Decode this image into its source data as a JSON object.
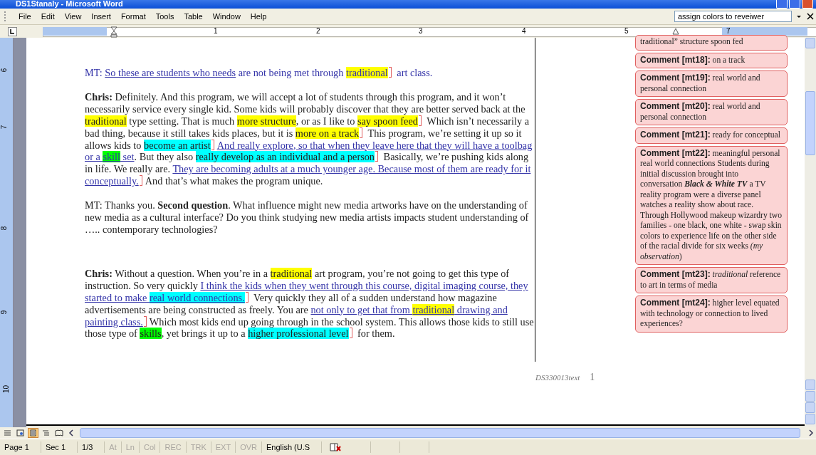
{
  "window": {
    "title": "DS1Stanaly - Microsoft Word"
  },
  "menu": [
    "File",
    "Edit",
    "View",
    "Insert",
    "Format",
    "Tools",
    "Table",
    "Window",
    "Help"
  ],
  "question_box": {
    "value": "assign colors to reveiwer"
  },
  "ruler": {
    "numbers": [
      "1",
      "2",
      "3",
      "4",
      "5",
      "7"
    ]
  },
  "vertical_ruler": {
    "numbers": [
      "6",
      "7",
      "8",
      "9",
      "10"
    ]
  },
  "paragraphs": [
    {
      "tracked": true,
      "runs": [
        {
          "text": "MT: "
        },
        {
          "text": "So these are students who needs",
          "inserted": true
        },
        {
          "text": " are not being met through "
        },
        {
          "text": "traditional",
          "color": "#ffff00",
          "comment": true
        },
        {
          "text": " art class."
        }
      ]
    },
    {
      "runs": [
        {
          "text": "Chris:",
          "bold": true
        },
        {
          "text": " Definitely.  And this program, we will accept a lot of students through this program, and it won’t necessarily service every single kid.  Some kids will probably discover that they are better served back at the "
        },
        {
          "text": "traditional",
          "color": "#ffff00"
        },
        {
          "text": " type setting.  That is much "
        },
        {
          "text": "more structure",
          "color": "#ffff00"
        },
        {
          "text": ", or as I like to "
        },
        {
          "text": "say spoon feed",
          "color": "#ffff00",
          "comment": true
        },
        {
          "text": "  Which isn’t necessarily a bad thing, because it still takes kids places, but it is "
        },
        {
          "text": "more on a track",
          "color": "#ffff00",
          "comment": true
        },
        {
          "text": "  This program, we’re setting it up so it allows kids to "
        },
        {
          "text": "become an artist",
          "color": "#00ffff",
          "comment": true
        },
        {
          "text": "And really explore, so that when they leave here that they will have a toolbag or a ",
          "inserted": true
        },
        {
          "text": "skill",
          "color": "#00ff00",
          "inserted": true
        },
        {
          "text": " set",
          "inserted": true
        },
        {
          "text": ".  But they also "
        },
        {
          "text": "really develop as an individual and a person",
          "color": "#00ffff",
          "comment": true
        },
        {
          "text": "  Basically, we’re pushing kids along in life.  We really are.  "
        },
        {
          "text": "They are becoming adults at a much younger age. Because most of them are ready for it conceptually.",
          "inserted": true,
          "comment": true
        },
        {
          "text": "And that’s what makes the program unique."
        }
      ]
    },
    {
      "runs": [
        {
          "text": "MT: Thanks you. "
        },
        {
          "text": "Second question",
          "bold": true
        },
        {
          "text": ". What influence might new media artworks have on the understanding of new media as a cultural interface? Do you think studying new media artists impacts student understanding of ….. contemporary technologies?"
        }
      ]
    },
    {
      "runs": [
        {
          "text": "Chris:",
          "bold": true
        },
        {
          "text": " Without a question.  When you’re in a "
        },
        {
          "text": "traditional",
          "color": "#ffff00"
        },
        {
          "text": " art program, you’re not going to get this type of instruction.  So very quickly "
        },
        {
          "text": "I think the kids when they went through this course, digital imaging course, they started to make ",
          "inserted": true
        },
        {
          "text": "real world connections.",
          "color": "#00ffff",
          "inserted": true,
          "comment": true
        },
        {
          "text": " Very quickly they all of a sudden understand how magazine advertisements are being constructed as freely.  You are "
        },
        {
          "text": "not only to get that from ",
          "inserted": true
        },
        {
          "text": "traditional",
          "color": "#ffff00",
          "inserted": true
        },
        {
          "text": " drawing and painting class.",
          "inserted": true,
          "comment": true
        },
        {
          "text": "Which most kids end up going through in the school system.  This allows those kids to still use those type of "
        },
        {
          "text": "skills",
          "color": "#00ff00"
        },
        {
          "text": ", yet brings it up to a "
        },
        {
          "text": "higher professional level",
          "color": "#00ffff",
          "comment": true
        },
        {
          "text": " for them."
        }
      ]
    }
  ],
  "footer": {
    "filename": "DS330013text",
    "page_number": "1"
  },
  "comments": [
    {
      "text": "traditional” structure spoon fed"
    },
    {
      "label": "Comment [mt18]:",
      "text": "on a track"
    },
    {
      "label": "Comment [mt19]:",
      "text": "real world and personal connection"
    },
    {
      "label": "Comment [mt20]:",
      "text": "real world and personal connection"
    },
    {
      "label": "Comment [mt21]:",
      "text": "ready for conceptual"
    },
    {
      "label": "Comment [mt22]:",
      "text": "meaningful personal real world connections Students during initial discussion brought into conversation **Black & White TV** a TV reality program were a diverse panel watches a reality show about race. Through Hollywood makeup wizardry two families - one black, one white - swap skin colors to experience life on the other side of the racial divide for six weeks *(my observation*)"
    },
    {
      "label": "Comment [mt23]:",
      "text": "*traditional* reference to art in terms of media"
    },
    {
      "label": "Comment [mt24]:",
      "text": "higher level equated with technology or connection to lived experiences?"
    }
  ],
  "view_buttons": [
    {
      "kind": "normal",
      "selected": false
    },
    {
      "kind": "web",
      "selected": false
    },
    {
      "kind": "print",
      "selected": true
    },
    {
      "kind": "outline",
      "selected": false
    },
    {
      "kind": "reading",
      "selected": false
    }
  ],
  "status_bar": [
    {
      "text": "Page 1",
      "disabled": false
    },
    {
      "text": "Sec 1",
      "disabled": false
    },
    {
      "text": "1/3",
      "disabled": false
    },
    {
      "text": "At",
      "disabled": true
    },
    {
      "text": "Ln",
      "disabled": true
    },
    {
      "text": "Col",
      "disabled": true
    },
    {
      "text": "REC",
      "disabled": true
    },
    {
      "text": "TRK",
      "disabled": true
    },
    {
      "text": "EXT",
      "disabled": true
    },
    {
      "text": "OVR",
      "disabled": true
    },
    {
      "text": "English (U.S",
      "disabled": false
    }
  ]
}
